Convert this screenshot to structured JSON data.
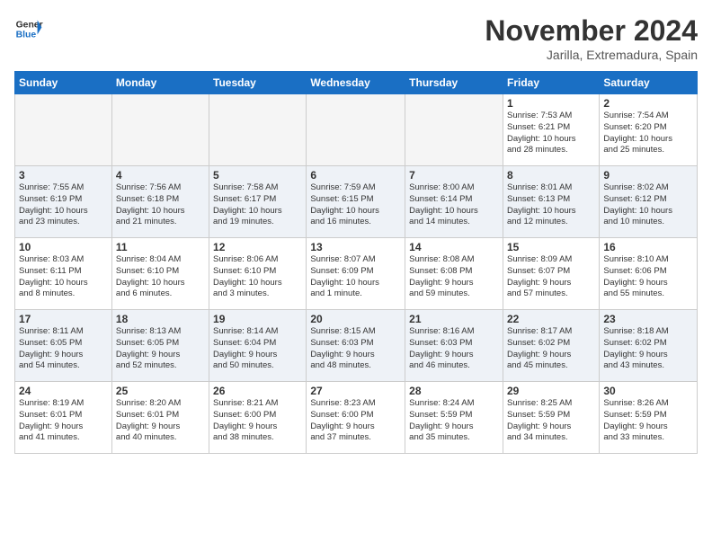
{
  "header": {
    "logo_line1": "General",
    "logo_line2": "Blue",
    "month": "November 2024",
    "location": "Jarilla, Extremadura, Spain"
  },
  "weekdays": [
    "Sunday",
    "Monday",
    "Tuesday",
    "Wednesday",
    "Thursday",
    "Friday",
    "Saturday"
  ],
  "weeks": [
    [
      {
        "day": "",
        "info": ""
      },
      {
        "day": "",
        "info": ""
      },
      {
        "day": "",
        "info": ""
      },
      {
        "day": "",
        "info": ""
      },
      {
        "day": "",
        "info": ""
      },
      {
        "day": "1",
        "info": "Sunrise: 7:53 AM\nSunset: 6:21 PM\nDaylight: 10 hours\nand 28 minutes."
      },
      {
        "day": "2",
        "info": "Sunrise: 7:54 AM\nSunset: 6:20 PM\nDaylight: 10 hours\nand 25 minutes."
      }
    ],
    [
      {
        "day": "3",
        "info": "Sunrise: 7:55 AM\nSunset: 6:19 PM\nDaylight: 10 hours\nand 23 minutes."
      },
      {
        "day": "4",
        "info": "Sunrise: 7:56 AM\nSunset: 6:18 PM\nDaylight: 10 hours\nand 21 minutes."
      },
      {
        "day": "5",
        "info": "Sunrise: 7:58 AM\nSunset: 6:17 PM\nDaylight: 10 hours\nand 19 minutes."
      },
      {
        "day": "6",
        "info": "Sunrise: 7:59 AM\nSunset: 6:15 PM\nDaylight: 10 hours\nand 16 minutes."
      },
      {
        "day": "7",
        "info": "Sunrise: 8:00 AM\nSunset: 6:14 PM\nDaylight: 10 hours\nand 14 minutes."
      },
      {
        "day": "8",
        "info": "Sunrise: 8:01 AM\nSunset: 6:13 PM\nDaylight: 10 hours\nand 12 minutes."
      },
      {
        "day": "9",
        "info": "Sunrise: 8:02 AM\nSunset: 6:12 PM\nDaylight: 10 hours\nand 10 minutes."
      }
    ],
    [
      {
        "day": "10",
        "info": "Sunrise: 8:03 AM\nSunset: 6:11 PM\nDaylight: 10 hours\nand 8 minutes."
      },
      {
        "day": "11",
        "info": "Sunrise: 8:04 AM\nSunset: 6:10 PM\nDaylight: 10 hours\nand 6 minutes."
      },
      {
        "day": "12",
        "info": "Sunrise: 8:06 AM\nSunset: 6:10 PM\nDaylight: 10 hours\nand 3 minutes."
      },
      {
        "day": "13",
        "info": "Sunrise: 8:07 AM\nSunset: 6:09 PM\nDaylight: 10 hours\nand 1 minute."
      },
      {
        "day": "14",
        "info": "Sunrise: 8:08 AM\nSunset: 6:08 PM\nDaylight: 9 hours\nand 59 minutes."
      },
      {
        "day": "15",
        "info": "Sunrise: 8:09 AM\nSunset: 6:07 PM\nDaylight: 9 hours\nand 57 minutes."
      },
      {
        "day": "16",
        "info": "Sunrise: 8:10 AM\nSunset: 6:06 PM\nDaylight: 9 hours\nand 55 minutes."
      }
    ],
    [
      {
        "day": "17",
        "info": "Sunrise: 8:11 AM\nSunset: 6:05 PM\nDaylight: 9 hours\nand 54 minutes."
      },
      {
        "day": "18",
        "info": "Sunrise: 8:13 AM\nSunset: 6:05 PM\nDaylight: 9 hours\nand 52 minutes."
      },
      {
        "day": "19",
        "info": "Sunrise: 8:14 AM\nSunset: 6:04 PM\nDaylight: 9 hours\nand 50 minutes."
      },
      {
        "day": "20",
        "info": "Sunrise: 8:15 AM\nSunset: 6:03 PM\nDaylight: 9 hours\nand 48 minutes."
      },
      {
        "day": "21",
        "info": "Sunrise: 8:16 AM\nSunset: 6:03 PM\nDaylight: 9 hours\nand 46 minutes."
      },
      {
        "day": "22",
        "info": "Sunrise: 8:17 AM\nSunset: 6:02 PM\nDaylight: 9 hours\nand 45 minutes."
      },
      {
        "day": "23",
        "info": "Sunrise: 8:18 AM\nSunset: 6:02 PM\nDaylight: 9 hours\nand 43 minutes."
      }
    ],
    [
      {
        "day": "24",
        "info": "Sunrise: 8:19 AM\nSunset: 6:01 PM\nDaylight: 9 hours\nand 41 minutes."
      },
      {
        "day": "25",
        "info": "Sunrise: 8:20 AM\nSunset: 6:01 PM\nDaylight: 9 hours\nand 40 minutes."
      },
      {
        "day": "26",
        "info": "Sunrise: 8:21 AM\nSunset: 6:00 PM\nDaylight: 9 hours\nand 38 minutes."
      },
      {
        "day": "27",
        "info": "Sunrise: 8:23 AM\nSunset: 6:00 PM\nDaylight: 9 hours\nand 37 minutes."
      },
      {
        "day": "28",
        "info": "Sunrise: 8:24 AM\nSunset: 5:59 PM\nDaylight: 9 hours\nand 35 minutes."
      },
      {
        "day": "29",
        "info": "Sunrise: 8:25 AM\nSunset: 5:59 PM\nDaylight: 9 hours\nand 34 minutes."
      },
      {
        "day": "30",
        "info": "Sunrise: 8:26 AM\nSunset: 5:59 PM\nDaylight: 9 hours\nand 33 minutes."
      }
    ]
  ]
}
